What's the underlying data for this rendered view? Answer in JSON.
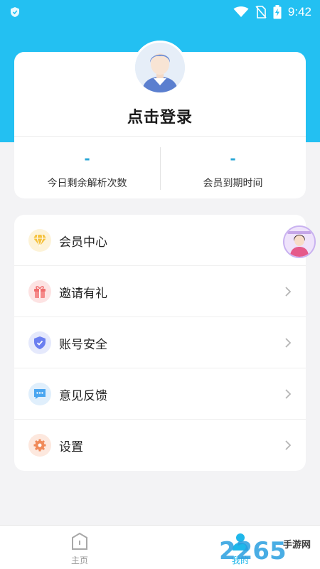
{
  "status_bar": {
    "time": "9:42",
    "icons": [
      "shield-icon",
      "wifi-icon",
      "no-sim-icon",
      "battery-charging-icon"
    ]
  },
  "profile": {
    "login_label": "点击登录",
    "stats": [
      {
        "value": "-",
        "label": "今日剩余解析次数"
      },
      {
        "value": "-",
        "label": "会员到期时间"
      }
    ]
  },
  "menu": {
    "items": [
      {
        "label": "会员中心",
        "icon": "diamond-icon",
        "color": "#f5c23e"
      },
      {
        "label": "邀请有礼",
        "icon": "gift-icon",
        "color": "#f06d6d"
      },
      {
        "label": "账号安全",
        "icon": "shield-check-icon",
        "color": "#6b7ff0"
      },
      {
        "label": "意见反馈",
        "icon": "message-icon",
        "color": "#4aa6f0"
      },
      {
        "label": "设置",
        "icon": "gear-icon",
        "color": "#f08a5a"
      }
    ]
  },
  "bottom_nav": {
    "items": [
      {
        "label": "主页",
        "icon": "home-icon",
        "active": false
      },
      {
        "label": "我的",
        "icon": "profile-icon",
        "active": true
      }
    ]
  },
  "watermark": {
    "text": "手游网",
    "number": "2265"
  },
  "colors": {
    "accent": "#23c0f2",
    "background": "#f3f3f5",
    "active_tab": "#1fb7ea"
  }
}
